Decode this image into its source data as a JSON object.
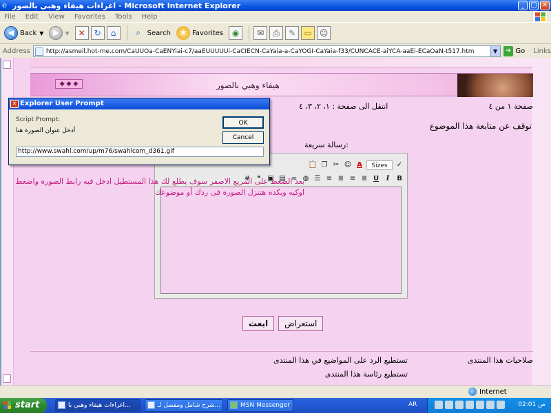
{
  "window": {
    "title": "اغراءات هيفاء وهبي بالصور - Microsoft Internet Explorer"
  },
  "menu": [
    "File",
    "Edit",
    "View",
    "Favorites",
    "Tools",
    "Help"
  ],
  "toolbar": {
    "back": "Back",
    "search": "Search",
    "favorites": "Favorites"
  },
  "address": {
    "label": "Address",
    "url": "http://asmeil.hot-me.com/CaUUOa-CaENYiai-c7/aaEUUUUUi-CaCIECN-CaYaia-a-CaYOGI-CaYaia-f33/CUNCACE-aiYCA-aaEi-ECaOaN-t517.htm",
    "go": "Go",
    "links": "Links"
  },
  "page": {
    "banner_title": "هيفاء وهبي بالصور",
    "banner_arrows": "◆ ◆ ◆",
    "page_of": "صفحة ١ من ٤",
    "goto_label": "انتقل الى صفحة : ١، ٢، ٣، ٤",
    "stop_follow": "توقف عن متابعة هذا الموضوع",
    "quick_message": "رسالة سريعة:",
    "hint": "بعد الضغط على المربع الاصفر سوف يطلع لك هذا المستطيل ادخل فيه رابط الصوره واضغط اوكيه وبكده هتنزل الصوره فى ردك أو موضوعك",
    "editor_sizes": "Sizes",
    "preview_button": "استعراض",
    "send_button": "ابعث",
    "permissions_title": "صلاحيات هذا المنتدى",
    "permissions_line1": "تستطيع الرد على المواضيع في هذا المنتدى",
    "permissions_line2": "تستطيع رئاسة هذا المنتدى"
  },
  "dialog": {
    "title": "Explorer User Prompt",
    "script_prompt": "Script Prompt:",
    "prompt_text": "أدخل عنوان الصورة هنا",
    "ok": "OK",
    "cancel": "Cancel",
    "input_value": "http://www.swahl.com/up/m76/swahlcom_d361.gif"
  },
  "status": {
    "zone": "Internet"
  },
  "taskbar": {
    "start": "start",
    "items": [
      "اغراءات هيفاء وهبي با...",
      "شرح شامل ومفصل لـ...",
      "MSN Messenger"
    ],
    "lang": "AR",
    "clock": "02:01 ص"
  },
  "colors": {
    "page_bg": "#f6d2f1",
    "hint_text": "#c21d7e",
    "xp_blue": "#0a54e3",
    "start_green": "#2d8a2b"
  }
}
